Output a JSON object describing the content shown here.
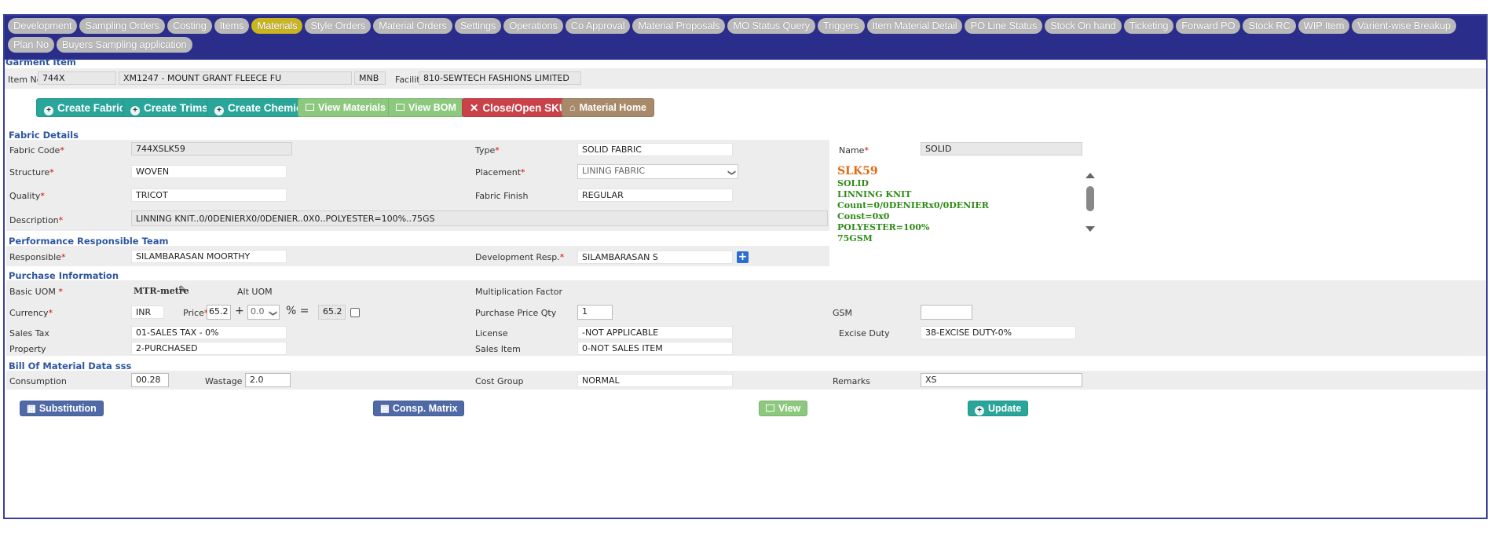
{
  "nav": {
    "tabs": [
      "Development",
      "Sampling Orders",
      "Costing",
      "Items",
      "Materials",
      "Style Orders",
      "Material Orders",
      "Settings",
      "Operations",
      "Co Approval",
      "Material Proposals",
      "MO Status Query",
      "Triggers",
      "Item Material Detail",
      "PO Line Status",
      "Stock On hand",
      "Ticketing",
      "Forward PO",
      "Stock RC",
      "WIP Item",
      "Varient-wise Breakup",
      "Plan No",
      "Buyers Sampling application"
    ],
    "active": "Materials"
  },
  "garment": {
    "title": "Garment Item",
    "item_no_label": "Item No.",
    "item_no": "744X",
    "item_desc": "XM1247 - MOUNT GRANT FLEECE FU",
    "item_code": "MNB",
    "facility_label": "Facility",
    "facility": "810-SEWTECH FASHIONS LIMITED"
  },
  "actions": {
    "create_fabric": "Create Fabric",
    "create_trims": "Create Trims",
    "create_chemical": "Create Chemical",
    "view_materials": "View Materials",
    "view_bom": "View BOM",
    "close_open_sku": "Close/Open SKU",
    "material_home": "Material Home"
  },
  "fabric": {
    "title": "Fabric Details",
    "fabric_code_label": "Fabric Code",
    "fabric_code": "744XSLK59",
    "type_label": "Type",
    "type": "SOLID FABRIC",
    "name_label": "Name",
    "name": "SOLID",
    "structure_label": "Structure",
    "structure": "WOVEN",
    "placement_label": "Placement",
    "placement": "LINING FABRIC",
    "quality_label": "Quality",
    "quality": "TRICOT",
    "finish_label": "Fabric Finish",
    "finish": "REGULAR",
    "description_label": "Description",
    "description": "LINNING KNIT..0/0DENIERX0/0DENIER..0X0..POLYESTER=100%..75GS"
  },
  "info_panel": {
    "heading": "SLK59",
    "lines": [
      "SOLID",
      "LINNING KNIT",
      "Count=0/0DENIERx0/0DENIER",
      "Const=0x0",
      "POLYESTER=100%",
      "75GSM"
    ]
  },
  "team": {
    "title": "Performance Responsible Team",
    "responsible_label": "Responsible",
    "responsible": "SILAMBARASAN MOORTHY",
    "dev_resp_label": "Development Resp.",
    "dev_resp": "SILAMBARASAN  S"
  },
  "purchase": {
    "title": "Purchase Information",
    "basic_uom_label": "Basic UOM",
    "basic_uom": "MTR-metre",
    "alt_uom_label": "Alt UOM",
    "mult_factor_label": "Multiplication Factor",
    "currency_label": "Currency",
    "currency": "INR",
    "price_label": "Price",
    "price": "65.2",
    "plus": "+",
    "pct_value": "0.0",
    "pct_eq": "% =",
    "net_price": "65.2",
    "ppq_label": "Purchase Price Qty",
    "ppq": "1",
    "gsm_label": "GSM",
    "gsm": "",
    "sales_tax_label": "Sales Tax",
    "sales_tax": "01-SALES TAX - 0%",
    "license_label": "License",
    "license": "-NOT APPLICABLE",
    "excise_label": "Excise Duty",
    "excise": "38-EXCISE DUTY-0%",
    "property_label": "Property",
    "property": "2-PURCHASED",
    "sales_item_label": "Sales Item",
    "sales_item": "0-NOT SALES ITEM"
  },
  "bom": {
    "title": "Bill Of Material Data sss",
    "consumption_label": "Consumption",
    "consumption": "00.28",
    "wastage_label": "Wastage %",
    "wastage": "2.0",
    "cost_group_label": "Cost Group",
    "cost_group": "NORMAL",
    "remarks_label": "Remarks",
    "remarks": "XS"
  },
  "footer": {
    "substitution": "Substitution",
    "consp_matrix": "Consp. Matrix",
    "view": "View",
    "update": "Update"
  },
  "colors": {
    "nav_bg": "#2a2d8a",
    "section_title": "#2e56a0",
    "teal": "#2aa59a",
    "info_heading": "#e06a14",
    "info_text": "#2f8a18"
  }
}
